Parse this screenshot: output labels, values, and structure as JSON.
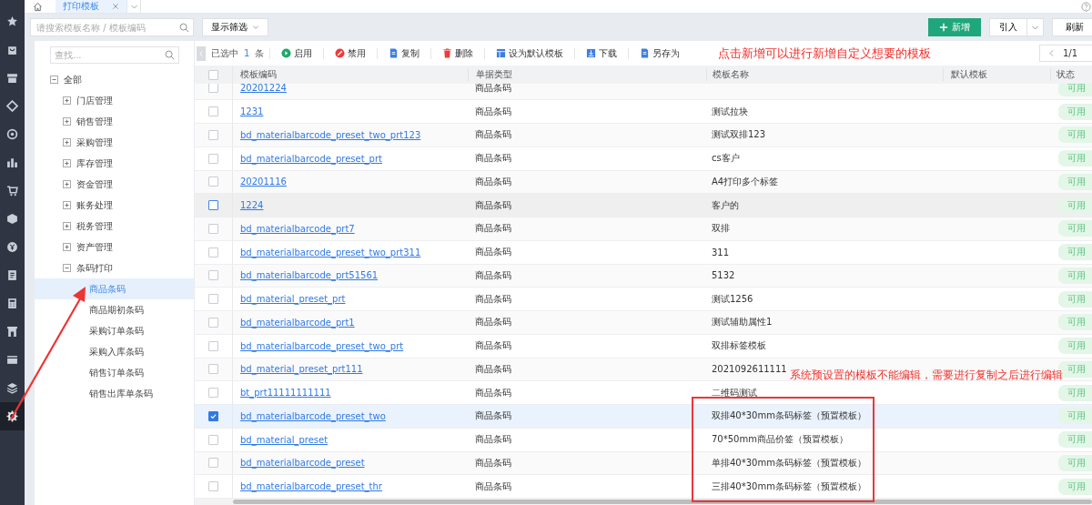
{
  "rail": [
    {
      "kind": "star",
      "selected": false
    },
    {
      "kind": "bag",
      "selected": false
    },
    {
      "kind": "store",
      "selected": false
    },
    {
      "kind": "tag",
      "selected": false
    },
    {
      "kind": "target",
      "selected": false
    },
    {
      "kind": "chart",
      "selected": false
    },
    {
      "kind": "cart",
      "selected": false
    },
    {
      "kind": "box",
      "selected": false
    },
    {
      "kind": "coin",
      "selected": false
    },
    {
      "kind": "doc",
      "selected": false
    },
    {
      "kind": "calc",
      "selected": false
    },
    {
      "kind": "shop",
      "selected": false
    },
    {
      "kind": "card",
      "selected": false
    },
    {
      "kind": "layers",
      "selected": false
    },
    {
      "kind": "gear",
      "selected": true
    }
  ],
  "tabs": [
    {
      "label": "打印模板",
      "selected": true
    }
  ],
  "search": {
    "placeholder": "请搜索模板名称 / 模板编码"
  },
  "filter_button": "显示筛选",
  "actions": {
    "add": "新增",
    "import": "引入",
    "refresh": "刷新"
  },
  "tree": {
    "placeholder": "查找...",
    "items": [
      {
        "label": "全部",
        "expanded": true,
        "selected": false,
        "children": [
          {
            "label": "门店管理",
            "expanded": false,
            "selected": false
          },
          {
            "label": "销售管理",
            "expanded": false,
            "selected": false
          },
          {
            "label": "采购管理",
            "expanded": false,
            "selected": false
          },
          {
            "label": "库存管理",
            "expanded": false,
            "selected": false
          },
          {
            "label": "资金管理",
            "expanded": false,
            "selected": false
          },
          {
            "label": "账务处理",
            "expanded": false,
            "selected": false
          },
          {
            "label": "税务管理",
            "expanded": false,
            "selected": false
          },
          {
            "label": "资产管理",
            "expanded": false,
            "selected": false
          },
          {
            "label": "条码打印",
            "expanded": true,
            "selected": false,
            "children": [
              {
                "label": "商品条码",
                "selected": true
              },
              {
                "label": "商品期初条码",
                "selected": false
              },
              {
                "label": "采购订单条码",
                "selected": false
              },
              {
                "label": "采购入库条码",
                "selected": false
              },
              {
                "label": "销售订单条码",
                "selected": false
              },
              {
                "label": "销售出库单条码",
                "selected": false
              }
            ]
          }
        ]
      }
    ]
  },
  "toolbar": {
    "selected_prefix": "已选中",
    "selected_count": "1",
    "selected_suffix": "条",
    "buttons": [
      {
        "kind": "enable",
        "label": "启用"
      },
      {
        "kind": "disable",
        "label": "禁用"
      },
      {
        "kind": "copy",
        "label": "复制"
      },
      {
        "kind": "delete",
        "label": "删除"
      },
      {
        "kind": "default",
        "label": "设为默认模板"
      },
      {
        "kind": "download",
        "label": "下载"
      },
      {
        "kind": "saveas",
        "label": "另存为"
      }
    ],
    "page": "1/1"
  },
  "table": {
    "all_checked": false,
    "columns": [
      "模板编码",
      "单据类型",
      "模板名称",
      "默认模板",
      "状态"
    ],
    "rows": [
      {
        "code": "20201224",
        "type": "商品条码",
        "status": "可用",
        "checked": false,
        "selected": false,
        "hovered": false
      },
      {
        "code": "1231",
        "type": "商品条码",
        "name": "测试拉块",
        "status": "可用",
        "checked": false,
        "selected": false,
        "hovered": false
      },
      {
        "code": "bd_materialbarcode_preset_two_prt123",
        "type": "商品条码",
        "name": "测试双排123",
        "status": "可用",
        "checked": false,
        "selected": false,
        "hovered": false
      },
      {
        "code": "bd_materialbarcode_preset_prt",
        "type": "商品条码",
        "name": "cs客户",
        "status": "可用",
        "checked": false,
        "selected": false,
        "hovered": false
      },
      {
        "code": "20201116",
        "type": "商品条码",
        "name": "A4打印多个标签",
        "status": "可用",
        "checked": false,
        "selected": false,
        "hovered": false
      },
      {
        "code": "1224",
        "type": "商品条码",
        "name": "客户的",
        "status": "可用",
        "checked": false,
        "selected": false,
        "hovered": true
      },
      {
        "code": "bd_materialbarcode_prt7",
        "type": "商品条码",
        "name": "双排",
        "status": "可用",
        "checked": false,
        "selected": false,
        "hovered": false
      },
      {
        "code": "bd_materialbarcode_preset_two_prt311",
        "type": "商品条码",
        "name": "311",
        "status": "可用",
        "checked": false,
        "selected": false,
        "hovered": false
      },
      {
        "code": "bd_materialbarcode_prt51561",
        "type": "商品条码",
        "name": "5132",
        "status": "可用",
        "checked": false,
        "selected": false,
        "hovered": false
      },
      {
        "code": "bd_material_preset_prt",
        "type": "商品条码",
        "name": "测试1256",
        "status": "可用",
        "checked": false,
        "selected": false,
        "hovered": false
      },
      {
        "code": "bd_materialbarcode_prt1",
        "type": "商品条码",
        "name": "测试辅助属性1",
        "status": "可用",
        "checked": false,
        "selected": false,
        "hovered": false
      },
      {
        "code": "bd_materialbarcode_preset_two_prt",
        "type": "商品条码",
        "name": "双排标签模板",
        "status": "可用",
        "checked": false,
        "selected": false,
        "hovered": false
      },
      {
        "code": "bd_material_preset_prt111",
        "type": "商品条码",
        "name": "2021092611111",
        "status": "可用",
        "checked": false,
        "selected": false,
        "hovered": false
      },
      {
        "code": "bt_prt11111111111",
        "type": "商品条码",
        "name": "二维码测试",
        "status": "可用",
        "checked": false,
        "selected": false,
        "hovered": false
      },
      {
        "code": "bd_materialbarcode_preset_two",
        "type": "商品条码",
        "name": "双排40*30mm条码标签（预置模板）",
        "status": "可用",
        "checked": true,
        "selected": true,
        "hovered": false
      },
      {
        "code": "bd_material_preset",
        "type": "商品条码",
        "name": "70*50mm商品价签（预置模板）",
        "status": "可用",
        "checked": false,
        "selected": false,
        "hovered": false
      },
      {
        "code": "bd_materialbarcode_preset",
        "type": "商品条码",
        "name": "单排40*30mm条码标签（预置模板）",
        "status": "可用",
        "checked": false,
        "selected": false,
        "hovered": false
      },
      {
        "code": "bd_materialbarcode_preset_thr",
        "type": "商品条码",
        "name": "三排40*30mm条码标签（预置模板）",
        "status": "可用",
        "checked": false,
        "selected": false,
        "hovered": false
      }
    ]
  },
  "annotations": {
    "toolbar_note": "点击新增可以进行新增自定义想要的模板",
    "table_note": "系统预设置的模板不能编辑，需要进行复制之后进行编辑"
  }
}
